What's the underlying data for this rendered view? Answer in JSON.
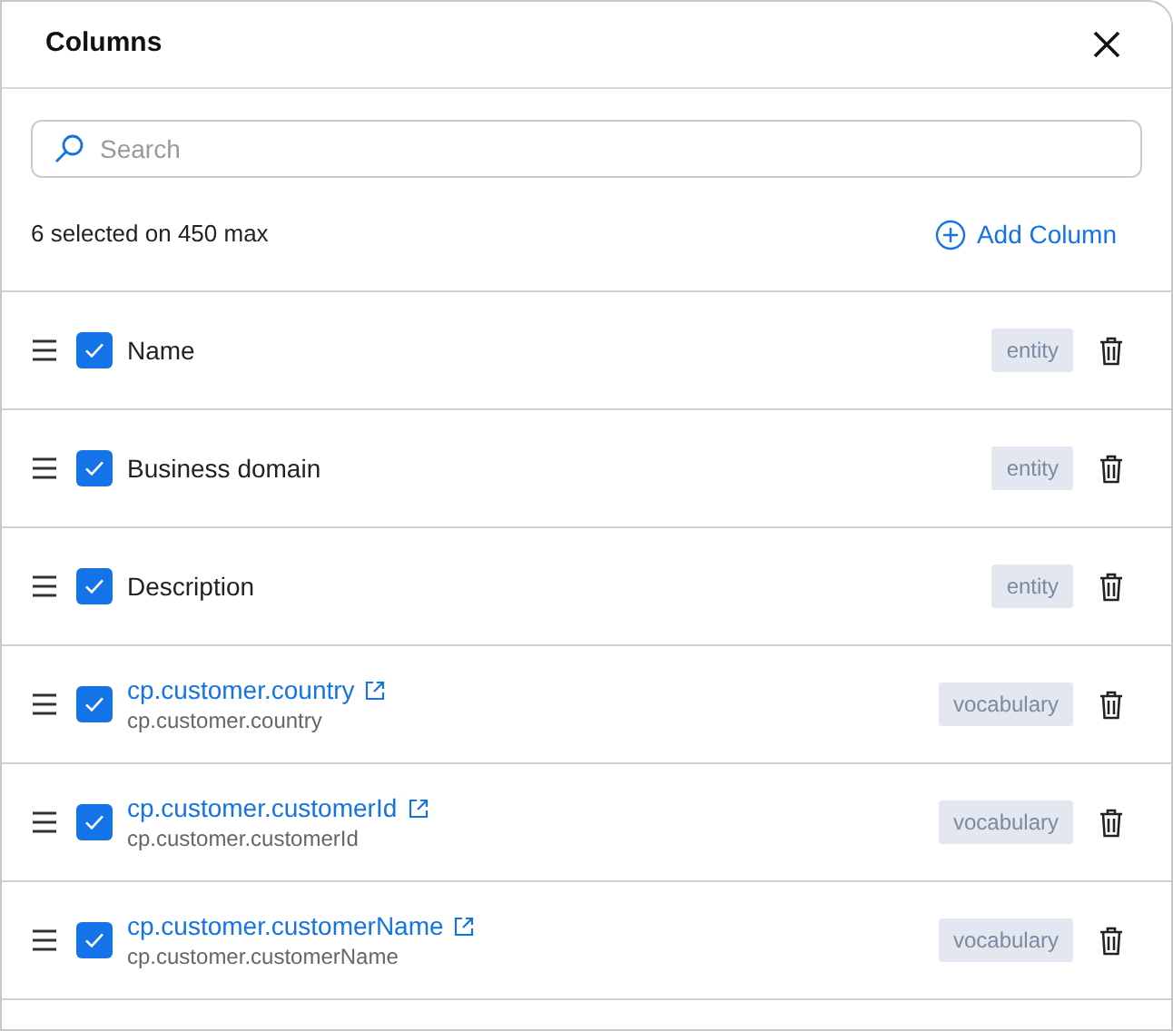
{
  "title": "Columns",
  "search": {
    "placeholder": "Search"
  },
  "count": "6 selected on 450 max",
  "add_button": "Add Column",
  "columns": [
    {
      "kind": "plain",
      "name": "Name",
      "checked": true,
      "tag": "entity"
    },
    {
      "kind": "plain",
      "name": "Business domain",
      "checked": true,
      "tag": "entity"
    },
    {
      "kind": "plain",
      "name": "Description",
      "checked": true,
      "tag": "entity"
    },
    {
      "kind": "link",
      "name": "cp.customer.country",
      "subtitle": "cp.customer.country",
      "checked": true,
      "tag": "vocabulary"
    },
    {
      "kind": "link",
      "name": "cp.customer.customerId",
      "subtitle": "cp.customer.customerId",
      "checked": true,
      "tag": "vocabulary"
    },
    {
      "kind": "link",
      "name": "cp.customer.customerName",
      "subtitle": "cp.customer.customerName",
      "checked": true,
      "tag": "vocabulary"
    }
  ]
}
